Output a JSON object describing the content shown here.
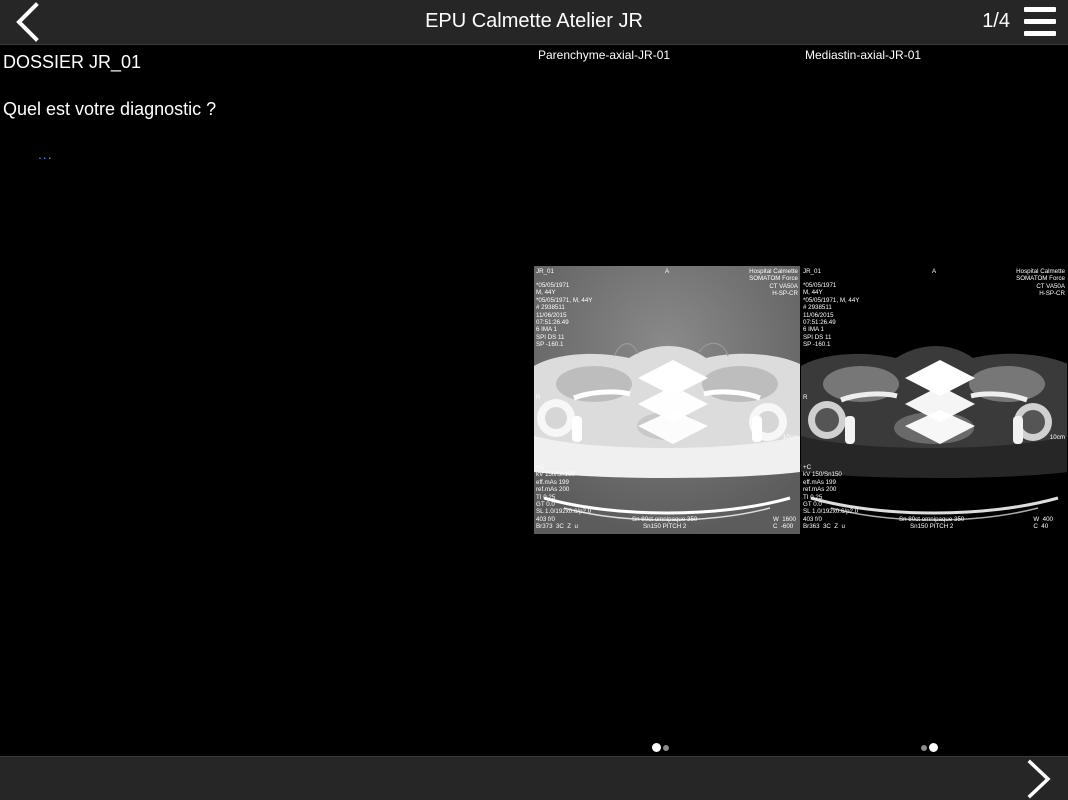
{
  "header": {
    "title": "EPU Calmette Atelier JR",
    "pager": "1/4"
  },
  "content": {
    "dossier": "DOSSIER JR_01",
    "question": "Quel est votre diagnostic ?",
    "more": "..."
  },
  "panels": [
    {
      "label": "Parenchyme-axial-JR-01",
      "window": "lung",
      "overlay": {
        "patient": "JR_01",
        "marker_top": "A",
        "site": "Hospital Calmette\nSOMATOM Force\nCT VA50A\nH-SP-CR",
        "left_info": "*05/05/1971\nM, 44Y\n*05/05/1971, M, 44Y\n# 2938511\n11/06/2015\n07:51:26.49\n6 IMA 1\nSPI DS 11\nSP -160.1",
        "marker_right": "R",
        "scale": "10cm",
        "bottom_info": "+C\nkV 150/Sn150\neff.mAs 199\nref.mAs 200\nTI 0.25\nGT 0.0\nSL 1.0/192x0.6/p2.0\n403 f/0\nBr373  3C  Z  u",
        "protocol": "Sn 80ct omnipaque 350\nSn150 PITCH 2",
        "wl": "W  1600\nC  -600"
      },
      "dots": {
        "active": 0,
        "count": 2
      }
    },
    {
      "label": "Mediastin-axial-JR-01",
      "window": "mediastinum",
      "overlay": {
        "patient": "JR_01",
        "marker_top": "A",
        "site": "Hospital Calmette\nSOMATOM Force\nCT VA50A\nH-SP-CR",
        "left_info": "*05/05/1971\nM, 44Y\n*05/05/1971, M, 44Y\n# 2938511\n11/06/2015\n07:51:26.49\n6 IMA 1\nSPI DS 11\nSP -160.1",
        "marker_right": "R",
        "scale": "10cm",
        "bottom_info": "+C\nkV 150/Sn150\neff.mAs 199\nref.mAs 200\nTI 0.25\nGT 0.0\nSL 1.0/192x0.6/p2.0\n403 f/0\nBr363  3C  Z  u",
        "protocol": "Sn 80ct omnipaque 350\nSn150 PITCH 2",
        "wl": "W  400\nC  40"
      },
      "dots": {
        "active": 1,
        "count": 2
      }
    }
  ],
  "colors": {
    "bar": "#262626",
    "background": "#000000",
    "link": "#4a8ef5",
    "dot_active": "#ffffff",
    "dot_inactive": "#8a8a8a"
  },
  "icons": {
    "back": "chevron-left-icon",
    "menu": "hamburger-menu-icon",
    "next": "chevron-right-icon",
    "stack": "image-stack-icon"
  }
}
